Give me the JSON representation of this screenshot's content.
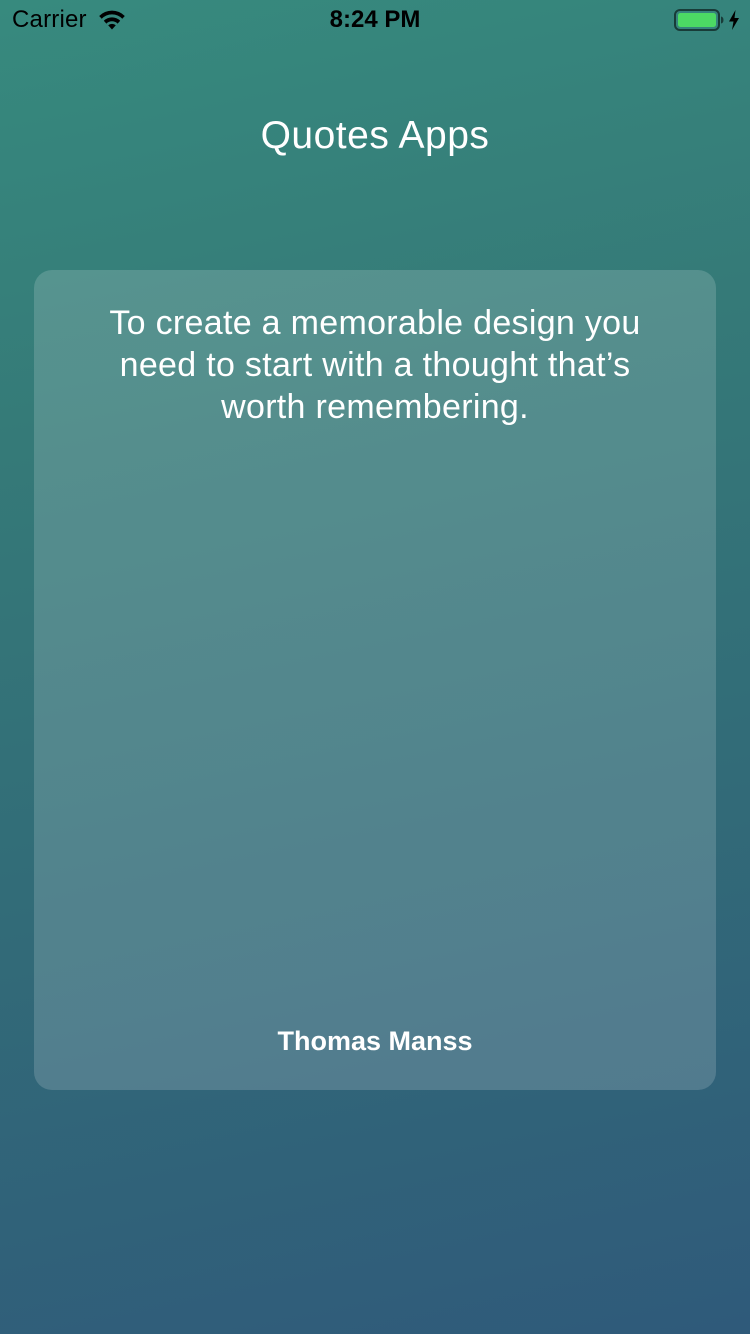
{
  "status_bar": {
    "carrier": "Carrier",
    "time": "8:24 PM",
    "wifi_icon": "wifi-icon",
    "battery_icon": "battery-icon",
    "charging_icon": "bolt-icon",
    "battery_color": "#4cd964"
  },
  "header": {
    "title": "Quotes Apps"
  },
  "quote": {
    "text": "To create a memorable design you need to start with a thought that’s worth remembering.",
    "author": "Thomas Manss"
  },
  "colors": {
    "background_top": "#378a7e",
    "background_bottom": "#2f5a7a",
    "text": "#ffffff"
  }
}
